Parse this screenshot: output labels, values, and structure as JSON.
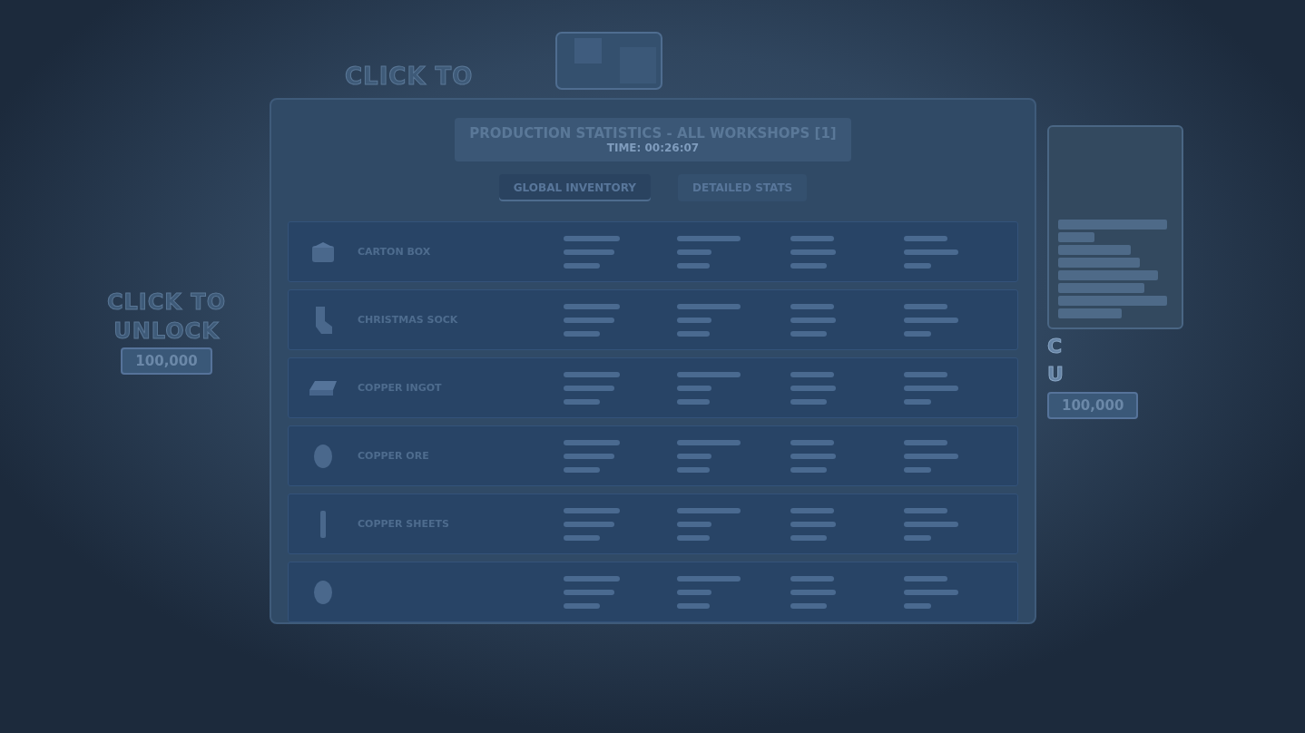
{
  "top_banner": {
    "label": "CLICK TO"
  },
  "left_unlock": {
    "lines": [
      "CLICK TO",
      "UNLOCK"
    ],
    "price": "100,000"
  },
  "dialog": {
    "title": "PRODUCTION STATISTICS - ALL WORKSHOPS [1]",
    "time": "TIME: 00:26:07",
    "tabs": [
      {
        "label": "GLOBAL INVENTORY",
        "selected": true
      },
      {
        "label": "DETAILED STATS",
        "selected": false
      }
    ],
    "items": [
      {
        "name": "CARTON BOX",
        "kind": "box"
      },
      {
        "name": "CHRISTMAS SOCK",
        "kind": "sock"
      },
      {
        "name": "COPPER INGOT",
        "kind": "ingot"
      },
      {
        "name": "COPPER ORE",
        "kind": "ore"
      },
      {
        "name": "COPPER SHEETS",
        "kind": "sheet"
      },
      {
        "kind": "ore"
      }
    ]
  },
  "right_unlock": {
    "lines": [
      "C",
      "U"
    ],
    "price": "100,000"
  }
}
